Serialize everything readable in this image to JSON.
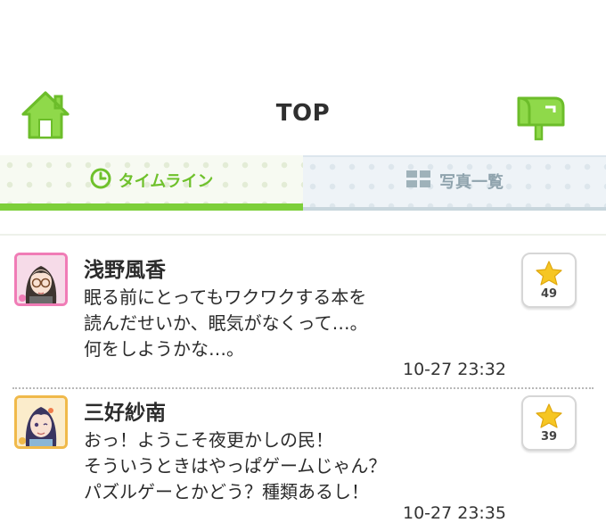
{
  "header": {
    "title": "TOP",
    "home_icon": "home-icon",
    "mail_icon": "mailbox-icon",
    "accent_color": "#7dcf3a"
  },
  "tabs": [
    {
      "label": "タイムライン",
      "icon": "clock-icon",
      "active": true
    },
    {
      "label": "写真一覧",
      "icon": "grid-icon",
      "active": false
    }
  ],
  "posts": [
    {
      "name": "浅野風香",
      "lines": [
        "眠る前にとってもワクワクする本を",
        "読んだせいか、眠気がなくって…。",
        "何をしようかな…。"
      ],
      "time": "10-27 23:32",
      "likes": "49"
    },
    {
      "name": "三好紗南",
      "lines": [
        "おっ！ようこそ夜更かしの民！",
        "そういうときはやっぱゲームじゃん？",
        "パズルゲーとかどう？種類あるし！"
      ],
      "time": "10-27 23:35",
      "likes": "39"
    }
  ]
}
